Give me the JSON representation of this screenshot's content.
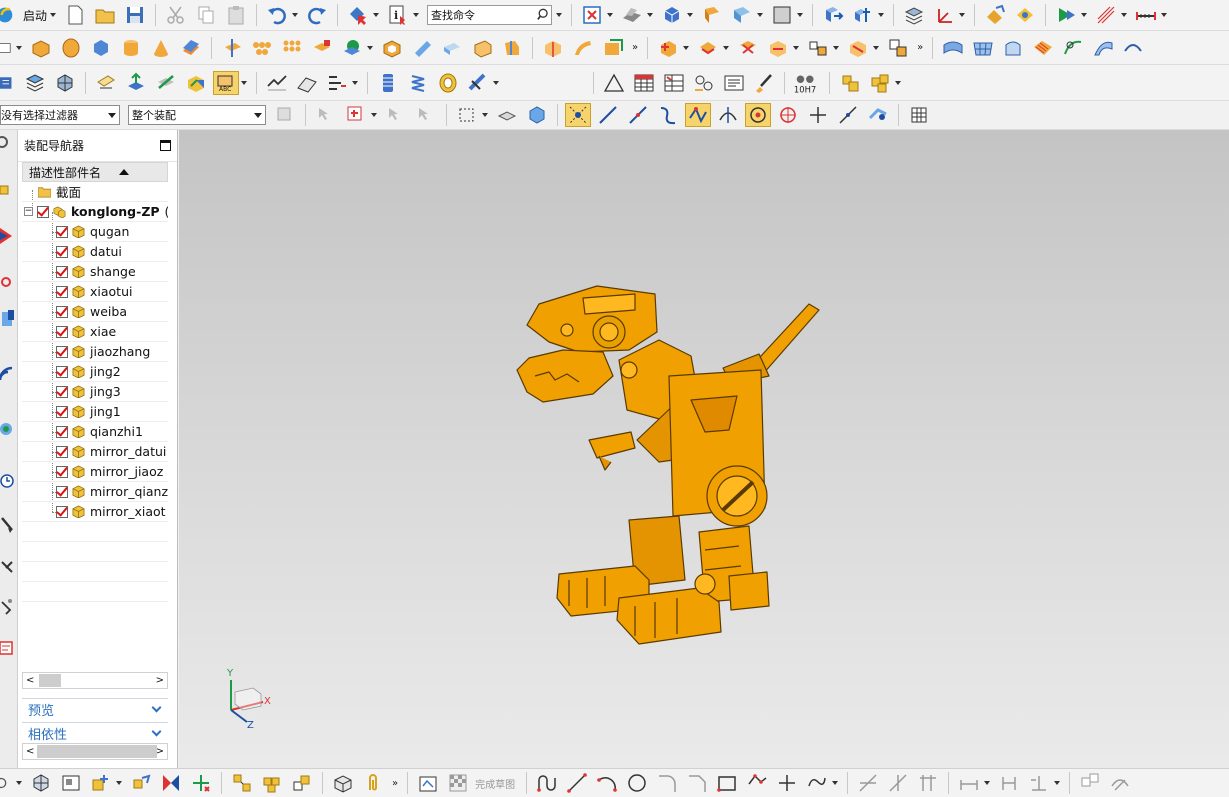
{
  "toolbar": {
    "start_label": "启动",
    "search_placeholder": "查找命令",
    "finish_sketch_label": "完成草图",
    "fit_label": "10H7"
  },
  "selection_bar": {
    "filter_value": "没有选择过滤器",
    "scope_value": "整个装配"
  },
  "navigator": {
    "title": "装配导航器",
    "column_header": "描述性部件名",
    "section_label": "截面",
    "root_label": "konglong-ZP",
    "root_suffix": "(",
    "parts": [
      {
        "name": "qugan"
      },
      {
        "name": "datui"
      },
      {
        "name": "shange"
      },
      {
        "name": "xiaotui"
      },
      {
        "name": "weiba"
      },
      {
        "name": "xiae"
      },
      {
        "name": "jiaozhang"
      },
      {
        "name": "jing2"
      },
      {
        "name": "jing3"
      },
      {
        "name": "jing1"
      },
      {
        "name": "qianzhi1"
      },
      {
        "name": "mirror_datui"
      },
      {
        "name": "mirror_jiaoz"
      },
      {
        "name": "mirror_qianz"
      },
      {
        "name": "mirror_xiaot"
      }
    ],
    "preview_label": "预览",
    "dependency_label": "相依性"
  },
  "viewport": {
    "model_color": "#f0a000",
    "triad": {
      "x": "X",
      "y": "Y",
      "z": "Z"
    }
  },
  "colors": {
    "accent": "#2a6fbf",
    "check": "#dd1111",
    "background_top": "#c4c4c4",
    "background_bottom": "#eaeaea"
  }
}
